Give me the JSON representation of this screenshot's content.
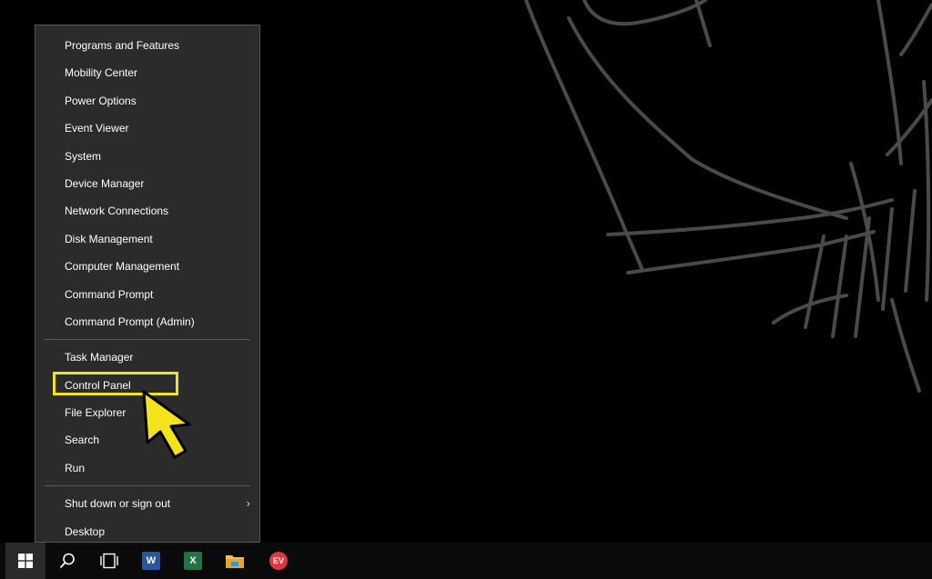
{
  "winx_menu": {
    "group1": [
      {
        "label": "Programs and Features"
      },
      {
        "label": "Mobility Center"
      },
      {
        "label": "Power Options"
      },
      {
        "label": "Event Viewer"
      },
      {
        "label": "System"
      },
      {
        "label": "Device Manager"
      },
      {
        "label": "Network Connections"
      },
      {
        "label": "Disk Management"
      },
      {
        "label": "Computer Management"
      },
      {
        "label": "Command Prompt"
      },
      {
        "label": "Command Prompt (Admin)"
      }
    ],
    "group2": [
      {
        "label": "Task Manager"
      },
      {
        "label": "Control Panel"
      },
      {
        "label": "File Explorer"
      },
      {
        "label": "Search"
      },
      {
        "label": "Run"
      }
    ],
    "group3": [
      {
        "label": "Shut down or sign out",
        "has_submenu": true
      },
      {
        "label": "Desktop"
      }
    ],
    "highlighted_item": "Control Panel"
  },
  "taskbar": {
    "icons": [
      {
        "name": "windows-start-icon"
      },
      {
        "name": "search-icon"
      },
      {
        "name": "task-view-icon"
      },
      {
        "name": "word-icon",
        "glyph": "W",
        "color": "#2b579a"
      },
      {
        "name": "excel-icon",
        "glyph": "X",
        "color": "#217346"
      },
      {
        "name": "file-explorer-icon",
        "color": "#f0c43c"
      },
      {
        "name": "expressvpn-icon",
        "glyph": "EV",
        "color": "#da3940"
      }
    ]
  },
  "colors": {
    "menu_bg": "#2b2b2b",
    "highlight": "#f2e31a",
    "taskbar_bg": "#0a0a0a"
  }
}
